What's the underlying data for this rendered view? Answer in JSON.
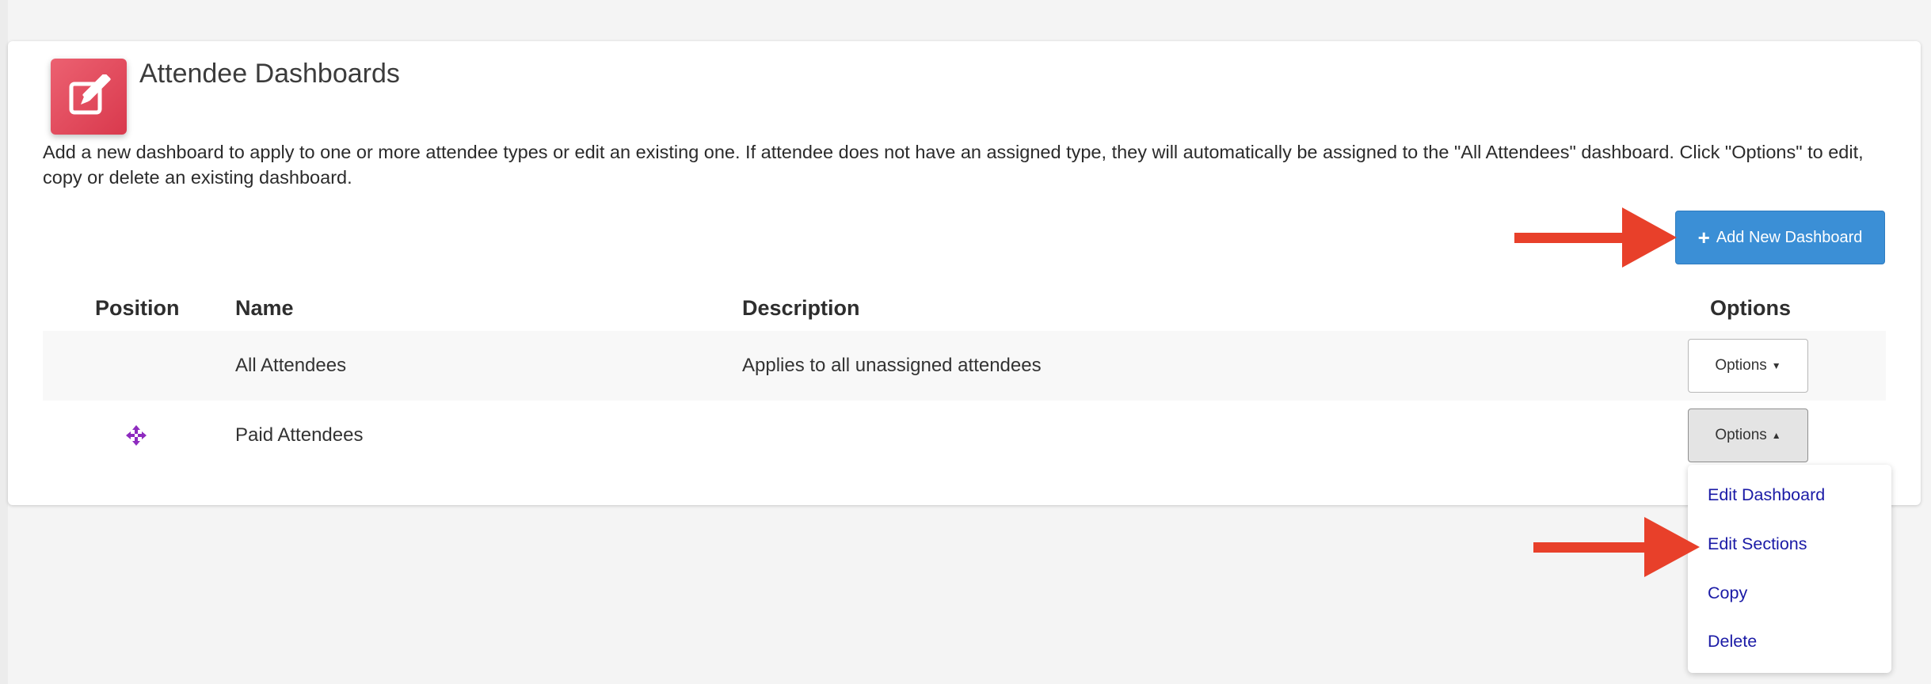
{
  "header": {
    "title": "Attendee Dashboards"
  },
  "intro": {
    "text": "Add a new dashboard to apply to one or more attendee types or edit an existing one. If attendee does not have an assigned type, they will automatically be assigned to the \"All Attendees\" dashboard. Click \"Options\" to edit, copy or delete an existing dashboard."
  },
  "toolbar": {
    "add_label": "Add New Dashboard",
    "add_icon": "plus-icon"
  },
  "table": {
    "columns": [
      "Position",
      "Name",
      "Description",
      "Options"
    ],
    "rows": [
      {
        "position": "",
        "name": "All Attendees",
        "description": "Applies to all unassigned attendees",
        "options_label": "Options",
        "options_open": false
      },
      {
        "position": "move-icon",
        "name": "Paid Attendees",
        "description": "",
        "options_label": "Options",
        "options_open": true
      }
    ]
  },
  "dropdown": {
    "items": [
      "Edit Dashboard",
      "Edit Sections",
      "Copy",
      "Delete"
    ]
  },
  "colors": {
    "accent_icon": "#e04a5e",
    "primary_button": "#3b8fd6",
    "link": "#1a1aa6",
    "annotation_arrow": "#e8402a",
    "move_icon": "#8e2bbf"
  }
}
